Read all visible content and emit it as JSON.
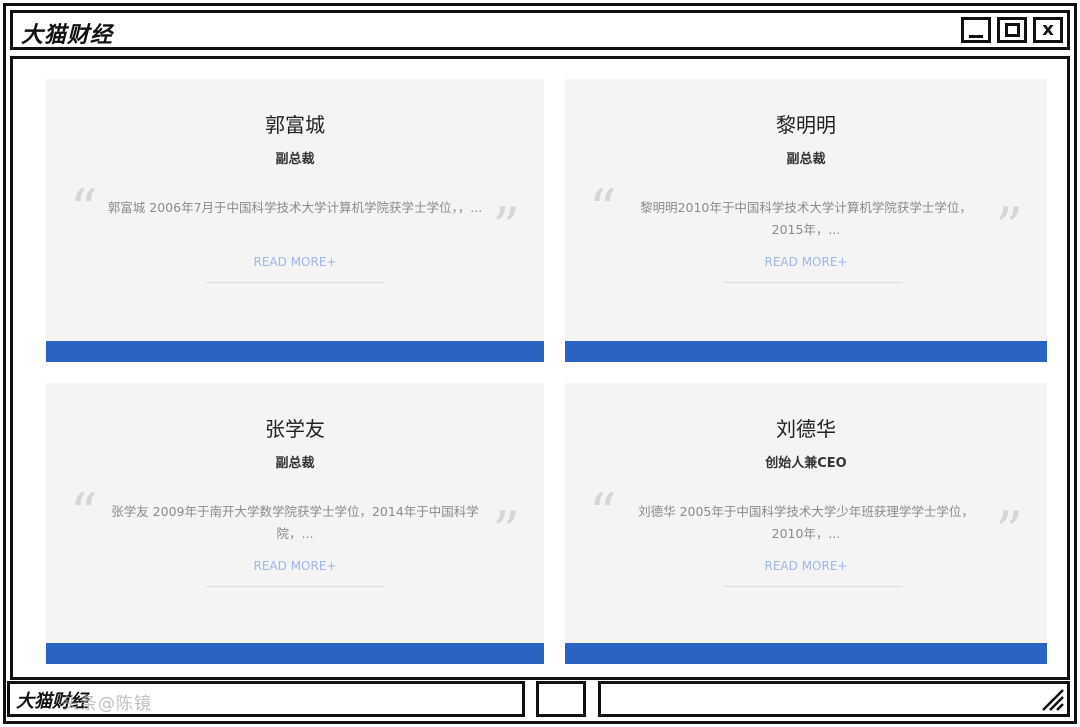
{
  "window": {
    "title": "大猫财经",
    "controls": {
      "minimize": "_",
      "maximize": "□",
      "close": "x"
    }
  },
  "cards": [
    {
      "name": "郭富城",
      "role": "副总裁",
      "bio": "郭富城 2006年7月于中国科学技术大学计算机学院获学士学位，，...",
      "read_more": "READ MORE+"
    },
    {
      "name": "黎明明",
      "role": "副总裁",
      "bio": "黎明明2010年于中国科学技术大学计算机学院获学士学位，2015年，...",
      "read_more": "READ MORE+"
    },
    {
      "name": "张学友",
      "role": "副总裁",
      "bio": "张学友 2009年于南开大学数学院获学士学位，2014年于中国科学院，...",
      "read_more": "READ MORE+"
    },
    {
      "name": "刘德华",
      "role": "创始人兼CEO",
      "bio": "刘德华 2005年于中国科学技术大学少年班获理学学士学位，2010年，...",
      "read_more": "READ MORE+"
    }
  ],
  "statusbar": {
    "title": "大猫财经",
    "watermark": "头条@陈镜"
  },
  "colors": {
    "accent": "#2b63c4",
    "link": "#9fb6e4",
    "card_bg": "#f4f4f4",
    "frame": "#111111"
  }
}
